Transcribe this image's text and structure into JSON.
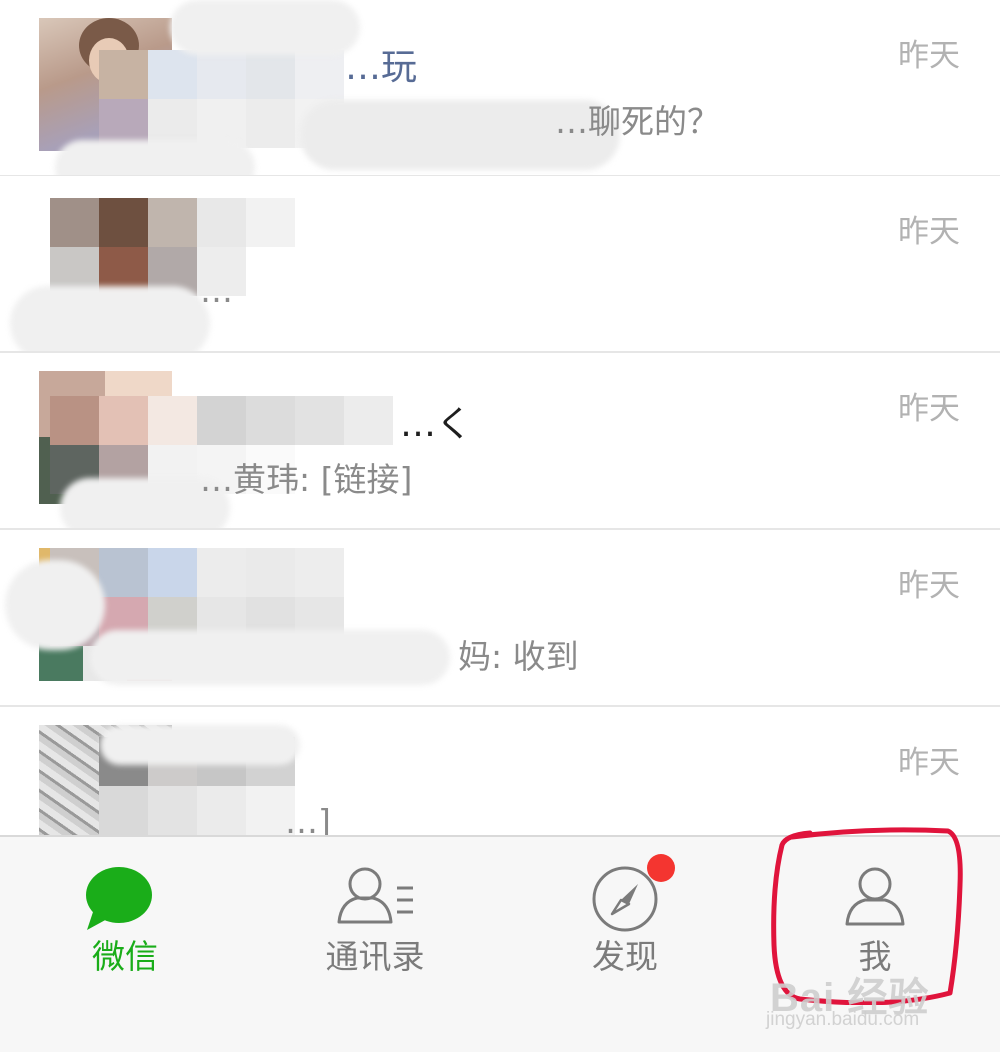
{
  "chats": [
    {
      "name": "…玩",
      "preview": "…聊死的？",
      "time": "昨天"
    },
    {
      "name": "",
      "preview": "…",
      "time": "昨天"
    },
    {
      "name": "…く",
      "preview": "…黄玮: [链接]",
      "time": "昨天"
    },
    {
      "name": "",
      "preview": "妈: 收到",
      "time": "昨天"
    },
    {
      "name": "",
      "preview": "…]",
      "time": "昨天"
    }
  ],
  "tabs": [
    {
      "label": "微信",
      "icon": "chat-bubble-icon",
      "active": true
    },
    {
      "label": "通讯录",
      "icon": "contacts-icon",
      "active": false
    },
    {
      "label": "发现",
      "icon": "compass-icon",
      "active": false,
      "badge": true
    },
    {
      "label": "我",
      "icon": "person-icon",
      "active": false,
      "highlighted": true
    }
  ],
  "colors": {
    "accent_green": "#1aad19",
    "badge_red": "#f43530",
    "annotation_red": "#e0143c",
    "tab_gray": "#7b7b7b"
  },
  "watermark": {
    "brand": "Bai 经验",
    "url": "jingyan.baidu.com"
  }
}
